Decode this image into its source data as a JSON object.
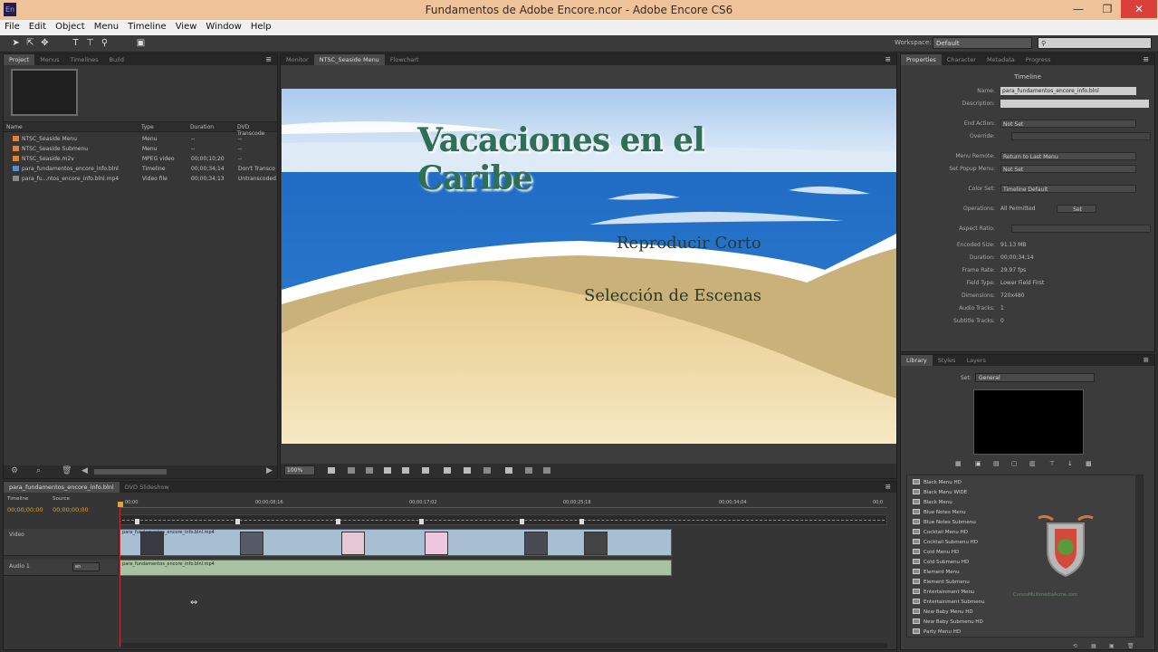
{
  "window": {
    "title": "Fundamentos de Adobe Encore.ncor - Adobe Encore CS6",
    "app_icon": "En",
    "min_glyph": "—",
    "max_glyph": "❐",
    "close_glyph": "✕"
  },
  "menu": [
    "File",
    "Edit",
    "Object",
    "Menu",
    "Timeline",
    "View",
    "Window",
    "Help"
  ],
  "workspace": {
    "label": "Workspace:",
    "value": "Default"
  },
  "project_panel": {
    "tabs": [
      "Project",
      "Menus",
      "Timelines",
      "Build"
    ],
    "columns": [
      "Name",
      "Type",
      "Duration",
      "DVD Transcode"
    ],
    "rows": [
      {
        "name": "NTSC_Seaside Menu",
        "type": "Menu",
        "duration": "--",
        "transcode": "--",
        "color": "#e0803a"
      },
      {
        "name": "NTSC_Seaside Submenu",
        "type": "Menu",
        "duration": "--",
        "transcode": "--",
        "color": "#e0803a"
      },
      {
        "name": "NTSC_Seaside.m2v",
        "type": "MPEG video",
        "duration": "00;00;10;20",
        "transcode": "--",
        "color": "#e0803a"
      },
      {
        "name": "para_fundamentos_encore_info.blnl",
        "type": "Timeline",
        "duration": "00;00;34;14",
        "transcode": "Don't Transco",
        "color": "#5a8ad0"
      },
      {
        "name": "para_fu...ntos_encore_info.blnl.mp4",
        "type": "Video file",
        "duration": "00;00;34;13",
        "transcode": "Untranscoded",
        "color": "#8a8a8a"
      }
    ]
  },
  "viewer": {
    "tabs": [
      "Monitor",
      "NTSC_Seaside Menu",
      "Flowchart"
    ],
    "menu_title": "Vacaciones en el Caribe",
    "buttons": [
      "Reproducir Corto",
      "Selección de Escenas"
    ],
    "zoom": "100%"
  },
  "properties": {
    "tabs": [
      "Properties",
      "Character",
      "Metadata",
      "Progress"
    ],
    "header": "Timeline",
    "fields": [
      {
        "label": "Name:",
        "value": "para_fundamentos_encore_info.blnl"
      },
      {
        "label": "Description:",
        "value": ""
      },
      {
        "label": "End Action:",
        "value": "Not Set"
      },
      {
        "label": "Override:",
        "value": ""
      },
      {
        "label": "Menu Remote:",
        "value": "Return to Last Menu"
      },
      {
        "label": "Set Popup Menu:",
        "value": "Not Set"
      },
      {
        "label": "Color Set:",
        "value": "Timeline Default"
      },
      {
        "label": "Operations:",
        "value": "All Permitted"
      },
      {
        "label": "Aspect Ratio:",
        "value": ""
      },
      {
        "label": "Encoded Size:",
        "value": "91.13 MB"
      },
      {
        "label": "Duration:",
        "value": "00;00;34;14"
      },
      {
        "label": "Frame Rate:",
        "value": "29.97 fps"
      },
      {
        "label": "Field Type:",
        "value": "Lower Field First"
      },
      {
        "label": "Dimensions:",
        "value": "720x480"
      },
      {
        "label": "Audio Tracks:",
        "value": "1"
      },
      {
        "label": "Subtitle Tracks:",
        "value": "0"
      }
    ],
    "set_button": "Set"
  },
  "library": {
    "tabs": [
      "Library",
      "Styles",
      "Layers"
    ],
    "set_label": "Set:",
    "set_value": "General",
    "items": [
      "Black Menu HD",
      "Black Menu WIDE",
      "Black Menu",
      "Blue Notes Menu",
      "Blue Notes Submenu",
      "Cocktail Menu HD",
      "Cocktail Submenu HD",
      "Cold Menu HD",
      "Cold Submenu HD",
      "Element Menu",
      "Element Submenu",
      "Entertainment Menu",
      "Entertainment Submenu",
      "New Baby Menu HD",
      "New Baby Submenu HD",
      "Party Menu HD"
    ],
    "watermark": "CursosMultimediaAcme.com"
  },
  "timeline": {
    "tabs": [
      "para_fundamentos_encore_info.blnl",
      "DVD Slideshow"
    ],
    "timecode_label": "Timeline",
    "timecode": "00;00;00;00",
    "source_label": "Source",
    "source_tc": "00;00;00;00",
    "ruler": [
      "00;00",
      "00;00;08;16",
      "00;00;17;02",
      "00;00;25;18",
      "00;00;34;04",
      "00;0"
    ],
    "video_label": "Video",
    "audio_label": "Audio 1",
    "audio_lang": "en",
    "video_clip": "para_fundamentos_encore_info.blnl.mp4",
    "audio_clip": "para_fundamentos_encore_info.blnl.mp4"
  }
}
